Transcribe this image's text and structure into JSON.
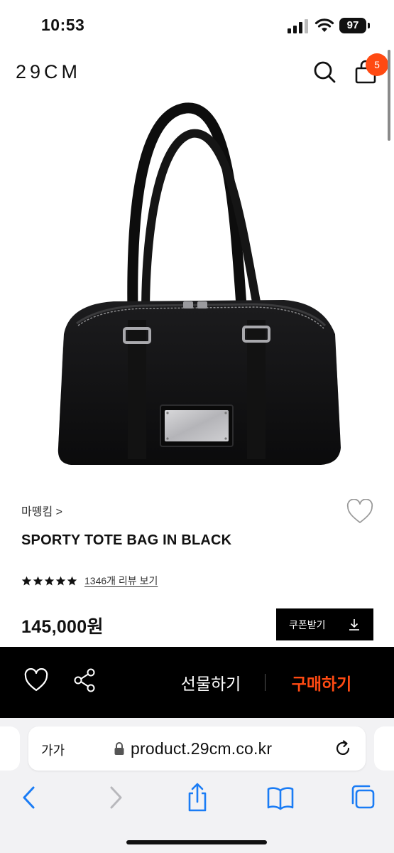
{
  "status_bar": {
    "time": "10:53",
    "battery": "97"
  },
  "header": {
    "logo": "29CM",
    "cart_count": "5"
  },
  "product": {
    "brand": "마뗑킴 >",
    "title": "SPORTY TOTE BAG IN BLACK",
    "rating_stars": 5,
    "review_link": "1346개 리뷰 보기",
    "price": "145,000원",
    "coupon_label": "쿠폰받기"
  },
  "purchase_bar": {
    "gift_label": "선물하기",
    "buy_label": "구매하기"
  },
  "browser": {
    "text_size_label": "가가",
    "url": "product.29cm.co.kr"
  },
  "colors": {
    "accent": "#ff4a12",
    "bar_bg": "#000000",
    "safari_bg": "#f2f2f4",
    "safari_blue": "#1a7cf5"
  }
}
